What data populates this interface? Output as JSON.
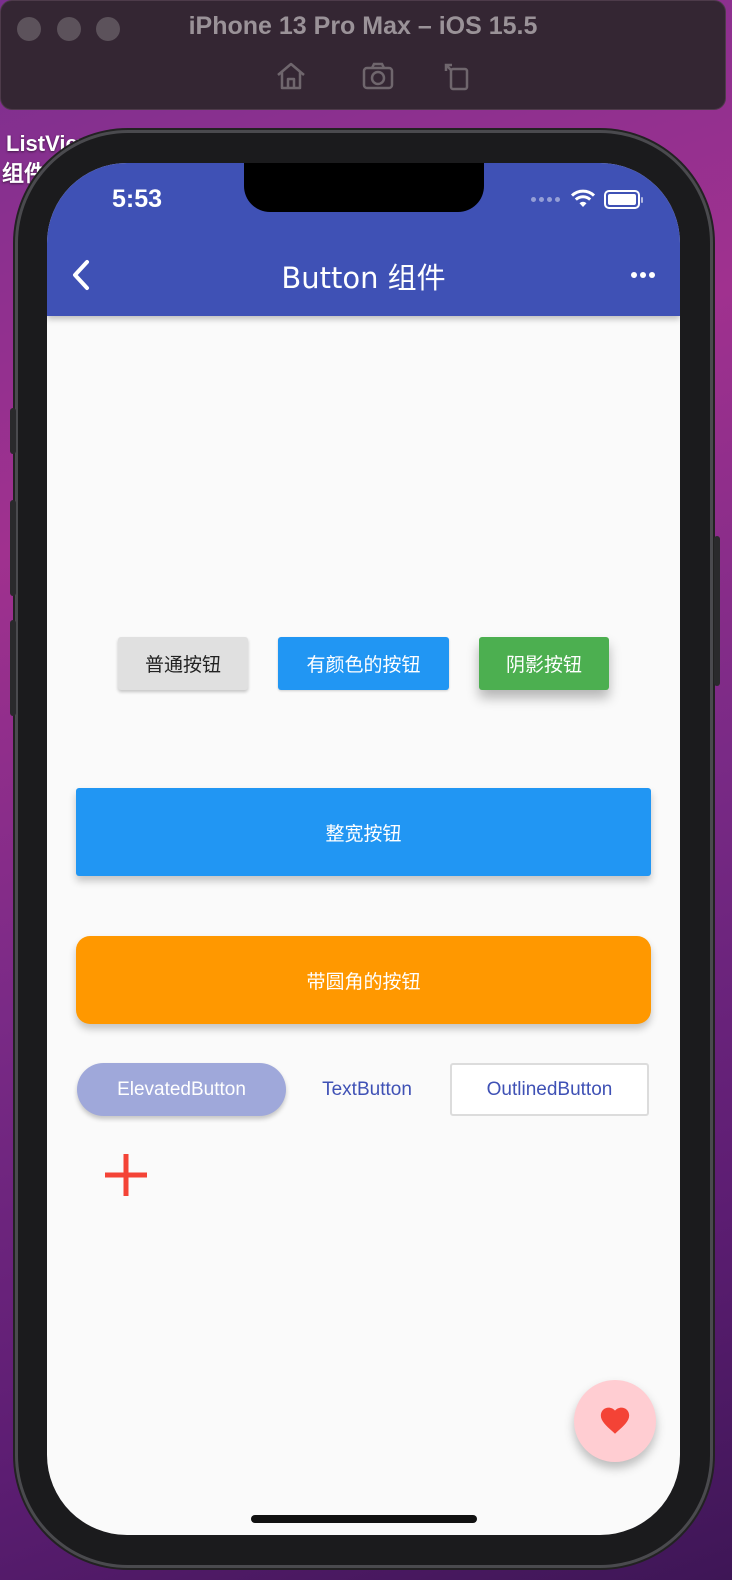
{
  "simulator": {
    "title": "iPhone 13 Pro Max – iOS 15.5",
    "tools": [
      "home-icon",
      "screenshot-icon",
      "rotate-icon"
    ]
  },
  "desktop_labels": {
    "top_line": "ListView 列表列表       示例项目          demo",
    "top_line2": "组件"
  },
  "status_bar": {
    "time": "5:53"
  },
  "app_bar": {
    "title": "Button 组件",
    "back_icon": "back-arrow-icon",
    "more_icon": "more-horizontal-icon",
    "color": "#3f51b5"
  },
  "buttons": {
    "plain": "普通按钮",
    "colored": "有颜色的按钮",
    "shadow": "阴影按钮",
    "wide": "整宽按钮",
    "rounded": "带圆角的按钮",
    "elevated": "ElevatedButton",
    "text": "TextButton",
    "outlined": "OutlinedButton"
  },
  "icon_button": {
    "icon": "add-icon",
    "color": "#f44336"
  },
  "fab": {
    "icon": "heart-icon",
    "background": "#ffcdd2",
    "icon_color": "#f44336"
  }
}
